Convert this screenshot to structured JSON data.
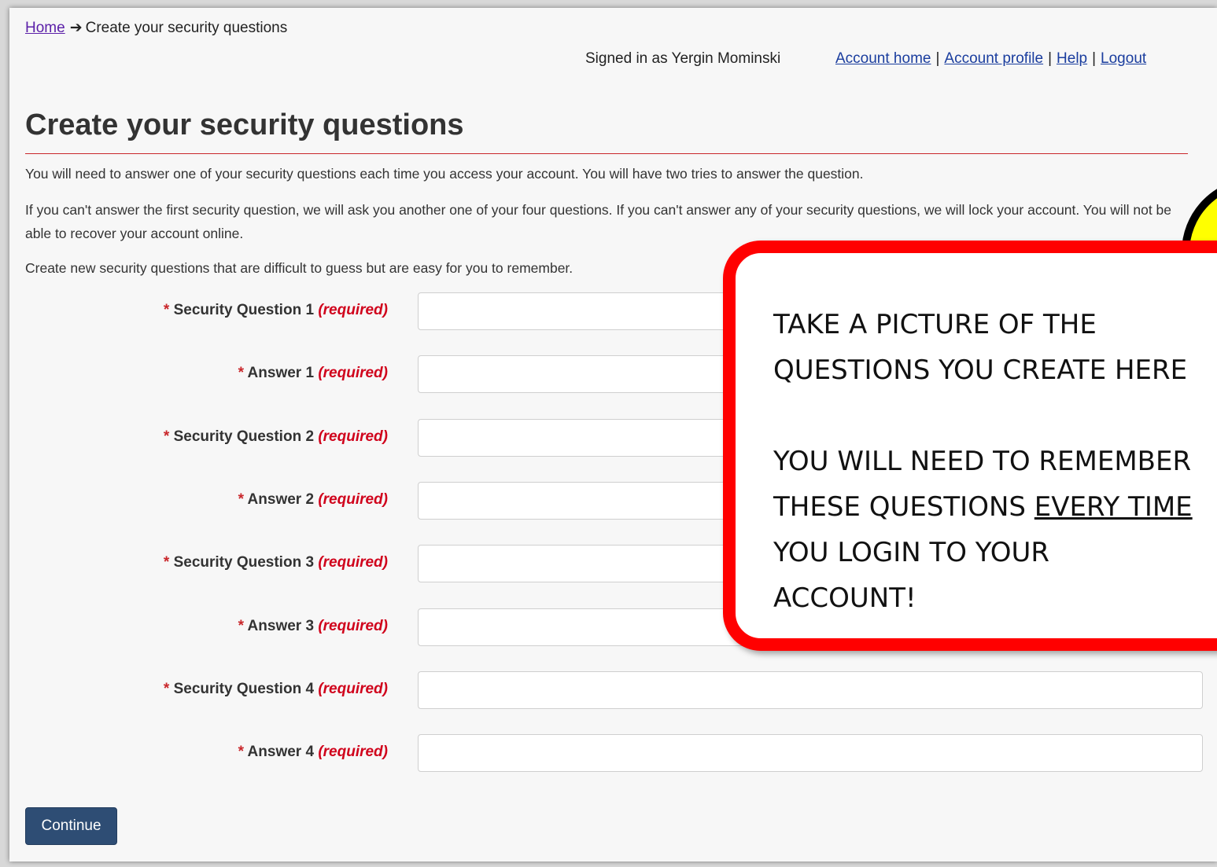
{
  "breadcrumb": {
    "home": "Home",
    "arrow": "➔",
    "current": "Create your security questions"
  },
  "header": {
    "signed_in": "Signed in as Yergin Mominski",
    "nav": {
      "account_home": "Account home",
      "account_profile": "Account profile",
      "help": "Help",
      "logout": "Logout",
      "separator": "|"
    }
  },
  "page": {
    "title": "Create your security questions",
    "intro": [
      "You will need to answer one of your security questions each time you access your account. You will have two tries to answer the question.",
      "If you can't answer the first security question, we will ask you another one of your four questions. If you can't answer any of your security questions, we will lock your account.  You will not be able to recover your account online.",
      "Create new security questions that are difficult to guess but are easy for you to remember."
    ]
  },
  "form": {
    "asterisk": "*",
    "required": "(required)",
    "fields": [
      {
        "label": "Security Question 1",
        "value": ""
      },
      {
        "label": "Answer 1",
        "value": ""
      },
      {
        "label": "Security Question 2",
        "value": ""
      },
      {
        "label": "Answer 2",
        "value": ""
      },
      {
        "label": "Security Question 3",
        "value": ""
      },
      {
        "label": "Answer 3",
        "value": ""
      },
      {
        "label": "Security Question 4",
        "value": ""
      },
      {
        "label": "Answer 4",
        "value": ""
      }
    ],
    "continue_label": "Continue"
  },
  "callout": {
    "line1": "TAKE A PICTURE OF THE",
    "line2": "QUESTIONS YOU CREATE HERE",
    "line3": "YOU WILL NEED TO REMEMBER",
    "line4_pre": "THESE QUESTIONS ",
    "line4_underlined": "EVERY TIME",
    "line5": "YOU LOGIN TO YOUR",
    "line6": "ACCOUNT!"
  },
  "colors": {
    "accent_red": "#c9272b",
    "callout_border": "#ff0000",
    "sticker_fill": "#ffff00",
    "button": "#2e4d74"
  }
}
